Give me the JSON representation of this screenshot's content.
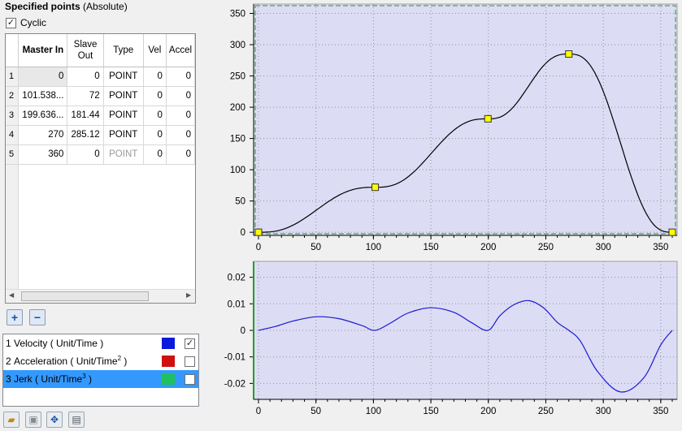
{
  "panel": {
    "title_bold": "Specified points",
    "title_suffix": "(Absolute)",
    "cyclic_label": "Cyclic",
    "cyclic_checked": true
  },
  "grid": {
    "columns": [
      "Master In",
      "Slave Out",
      "Type",
      "Vel",
      "Accel"
    ],
    "rows": [
      {
        "n": "1",
        "master": "0",
        "slave": "0",
        "type": "POINT",
        "vel": "0",
        "accel": "0"
      },
      {
        "n": "2",
        "master": "101.538...",
        "slave": "72",
        "type": "POINT",
        "vel": "0",
        "accel": "0"
      },
      {
        "n": "3",
        "master": "199.636...",
        "slave": "181.44",
        "type": "POINT",
        "vel": "0",
        "accel": "0"
      },
      {
        "n": "4",
        "master": "270",
        "slave": "285.12",
        "type": "POINT",
        "vel": "0",
        "accel": "0"
      },
      {
        "n": "5",
        "master": "360",
        "slave": "0",
        "type": "POINT",
        "vel": "0",
        "accel": "0"
      }
    ]
  },
  "buttons": {
    "add": "+",
    "remove": "−"
  },
  "legend": [
    {
      "n": "1",
      "label": "Velocity ( Unit/Time )",
      "sup": "",
      "color": "#0a1adc",
      "checked": true
    },
    {
      "n": "2",
      "label": "Acceleration ( Unit/Time",
      "sup": "2",
      "color": "#d01010",
      "checked": false
    },
    {
      "n": "3",
      "label": "Jerk ( Unit/Time",
      "sup": "3",
      "color": "#20c060",
      "checked": false
    }
  ],
  "toolbar": [
    "open-icon",
    "save-icon",
    "move-icon",
    "properties-icon"
  ],
  "colors": {
    "plot_bg": "#dcdcf4",
    "pos_line": "#000000",
    "vel_line": "#1a1ad0",
    "marker": "#ffff00",
    "grid": "#9090a0",
    "accent_green": "#2a9a2a"
  },
  "chart_data": [
    {
      "type": "line",
      "name": "position",
      "x": [
        0,
        101.538,
        199.636,
        270,
        360
      ],
      "y": [
        0,
        72,
        181.44,
        285.12,
        0
      ],
      "xticks": [
        0,
        50,
        100,
        150,
        200,
        250,
        300,
        350
      ],
      "yticks": [
        0,
        50,
        100,
        150,
        200,
        250,
        300,
        350
      ],
      "xlim": [
        0,
        360
      ],
      "ylim": [
        -5,
        365
      ],
      "grid": true,
      "markers": [
        [
          0,
          0
        ],
        [
          101.538,
          72
        ],
        [
          199.636,
          181.44
        ],
        [
          270,
          285.12
        ],
        [
          360,
          0
        ]
      ]
    },
    {
      "type": "line",
      "name": "velocity",
      "x": [
        0,
        15,
        30,
        50,
        70,
        90,
        101.5,
        115,
        130,
        150,
        170,
        185,
        199.6,
        210,
        222,
        235,
        248,
        260,
        270,
        280,
        295,
        315,
        335,
        350,
        360
      ],
      "y": [
        0,
        0.0015,
        0.0035,
        0.0051,
        0.0044,
        0.0018,
        0,
        0.0028,
        0.0065,
        0.0085,
        0.0068,
        0.003,
        0,
        0.0055,
        0.0096,
        0.0112,
        0.0085,
        0.003,
        0,
        -0.004,
        -0.0155,
        -0.0232,
        -0.018,
        -0.0055,
        0
      ],
      "xticks": [
        0,
        50,
        100,
        150,
        200,
        250,
        300,
        350
      ],
      "yticks": [
        0.02,
        0.01,
        0,
        -0.01,
        -0.02
      ],
      "ytick_labels": [
        "0.02",
        "0.01",
        "0",
        "-0.01",
        "-0.02"
      ],
      "xlim": [
        0,
        360
      ],
      "ylim": [
        -0.026,
        0.026
      ],
      "grid": true
    }
  ]
}
